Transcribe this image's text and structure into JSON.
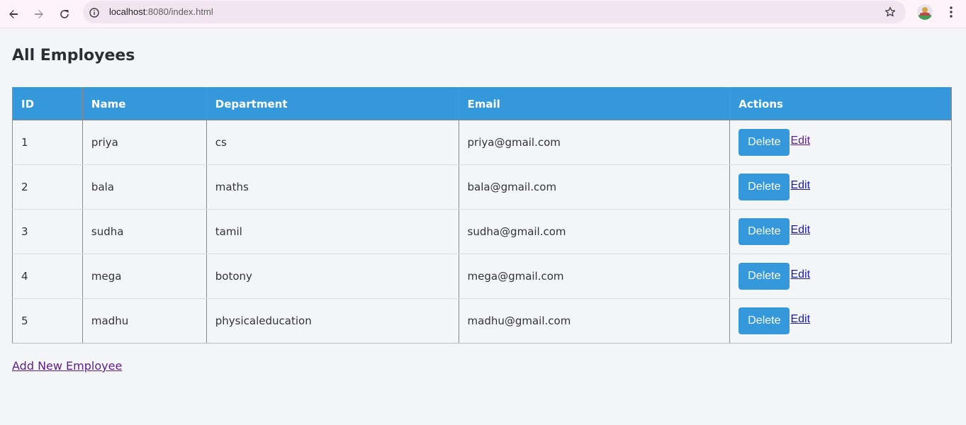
{
  "browser": {
    "url_host": "localhost",
    "url_path": ":8080/index.html"
  },
  "page": {
    "title": "All Employees",
    "add_link": "Add New Employee"
  },
  "table": {
    "headers": [
      "ID",
      "Name",
      "Department",
      "Email",
      "Actions"
    ],
    "rows": [
      {
        "id": "1",
        "name": "priya",
        "department": "cs",
        "email": "priya@gmail.com",
        "delete": "Delete",
        "edit": "Edit"
      },
      {
        "id": "2",
        "name": "bala",
        "department": "maths",
        "email": "bala@gmail.com",
        "delete": "Delete",
        "edit": "Edit"
      },
      {
        "id": "3",
        "name": "sudha",
        "department": "tamil",
        "email": "sudha@gmail.com",
        "delete": "Delete",
        "edit": "Edit"
      },
      {
        "id": "4",
        "name": "mega",
        "department": "botony",
        "email": "mega@gmail.com",
        "delete": "Delete",
        "edit": "Edit"
      },
      {
        "id": "5",
        "name": "madhu",
        "department": "physicaleducation",
        "email": "madhu@gmail.com",
        "delete": "Delete",
        "edit": "Edit"
      }
    ]
  },
  "colors": {
    "accent": "#3498db",
    "visited_link": "#5d1e8a",
    "link": "#1a1aa6"
  }
}
